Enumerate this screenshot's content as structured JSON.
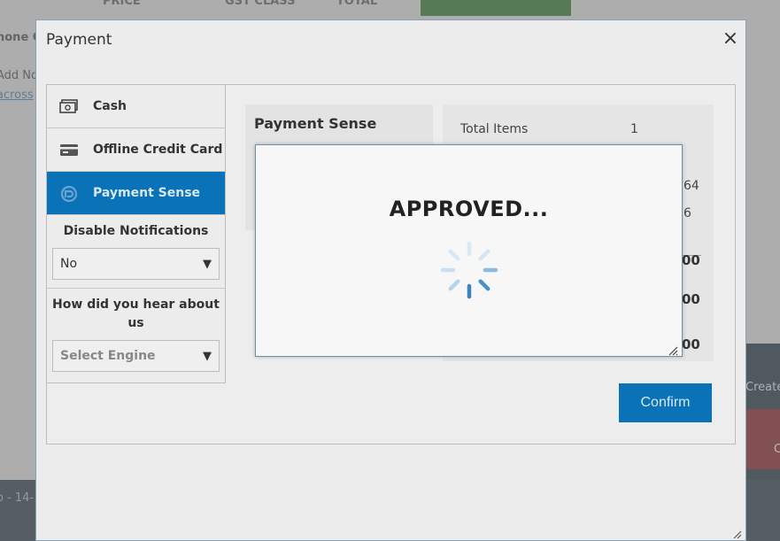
{
  "background": {
    "columns": [
      "PRICE",
      "GST CLASS",
      "TOTAL"
    ],
    "left_lines": [
      "hone C",
      "Add No",
      "across"
    ],
    "right_label": "Create",
    "right_letter": "C",
    "footer_fragment": "o - 14-"
  },
  "window": {
    "title": "Payment",
    "close_glyph": "×"
  },
  "menu": {
    "items": [
      {
        "label": "Cash",
        "icon": "cash-icon"
      },
      {
        "label": "Offline Credit Card",
        "icon": "credit-card-icon"
      },
      {
        "label": "Payment Sense",
        "icon": "payment-sense-icon",
        "active": true
      }
    ],
    "notifications": {
      "label": "Disable Notifications",
      "value": "No"
    },
    "referral": {
      "label": "How did you hear about us",
      "placeholder": "Select Engine"
    },
    "dropdown_glyph": "▼"
  },
  "pane": {
    "method_title": "Payment Sense",
    "summary": {
      "total_items_label": "Total Items",
      "total_items_value": "1",
      "partial_1": "64",
      "partial_2": "6",
      "amount_1": "00",
      "amount_2": "00",
      "amount_3": "00"
    },
    "confirm_label": "Confirm"
  },
  "dialog": {
    "message": "APPROVED..."
  },
  "colors": {
    "accent": "#0a73b7",
    "spinner": "#4a90c8"
  }
}
